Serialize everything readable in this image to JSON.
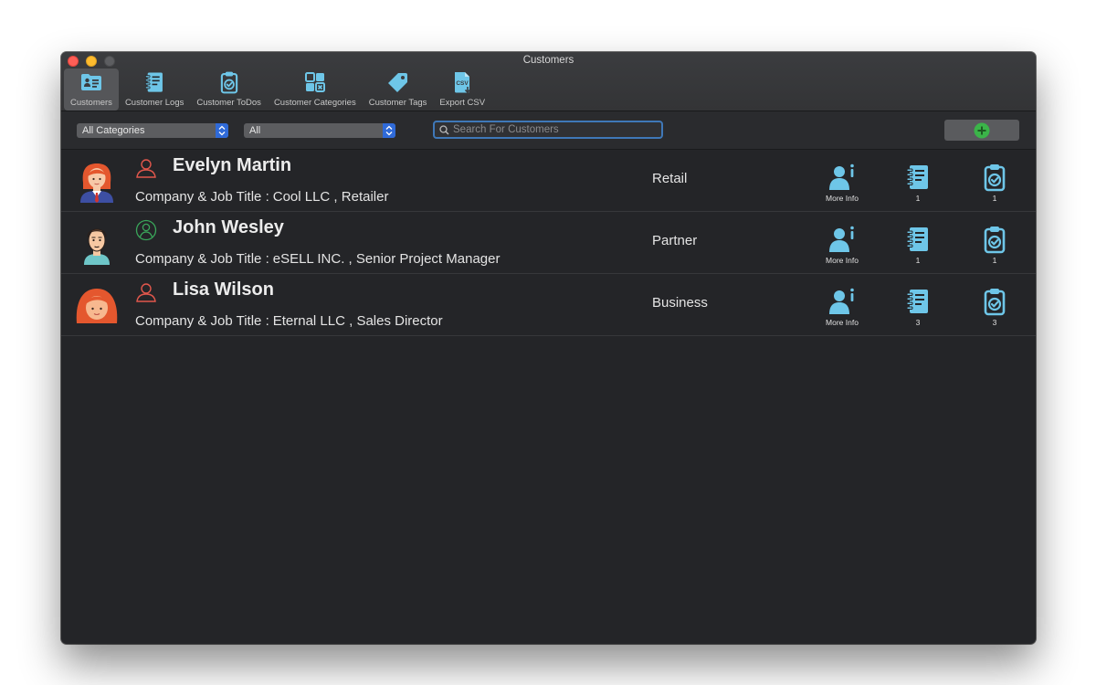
{
  "window": {
    "title": "Customers"
  },
  "toolbar": {
    "items": [
      {
        "label": "Customers",
        "icon": "customer-card-icon",
        "active": true
      },
      {
        "label": "Customer Logs",
        "icon": "notebook-icon"
      },
      {
        "label": "Customer ToDos",
        "icon": "clipboard-check-icon"
      },
      {
        "label": "Customer Categories",
        "icon": "categories-grid-icon"
      },
      {
        "label": "Customer Tags",
        "icon": "tags-icon"
      },
      {
        "label": "Export CSV",
        "icon": "csv-file-icon"
      }
    ]
  },
  "filters": {
    "category_select": "All Categories",
    "tag_select": "All",
    "search_placeholder": "Search For Customers"
  },
  "labels": {
    "company_job_prefix": "Company & Job Title :",
    "more_info": "More Info"
  },
  "customers": [
    {
      "name": "Evelyn Martin",
      "company_job": "Cool LLC , Retailer",
      "category": "Retail",
      "logs": "1",
      "todos": "1",
      "status_color": "#e2574c",
      "avatar": "woman-red-hair-suit"
    },
    {
      "name": "John Wesley",
      "company_job": "eSELL INC. , Senior Project Manager",
      "category": "Partner",
      "logs": "1",
      "todos": "1",
      "status_color": "#3aa65a",
      "avatar": "man-brown-hair"
    },
    {
      "name": "Lisa Wilson",
      "company_job": "Eternal LLC , Sales Director",
      "category": "Business",
      "logs": "3",
      "todos": "3",
      "status_color": "#e2574c",
      "avatar": "woman-red-hair"
    }
  ],
  "colors": {
    "accent": "#6ec6e8",
    "add_button": "#3bb449",
    "stepper": "#2f6ad8"
  }
}
